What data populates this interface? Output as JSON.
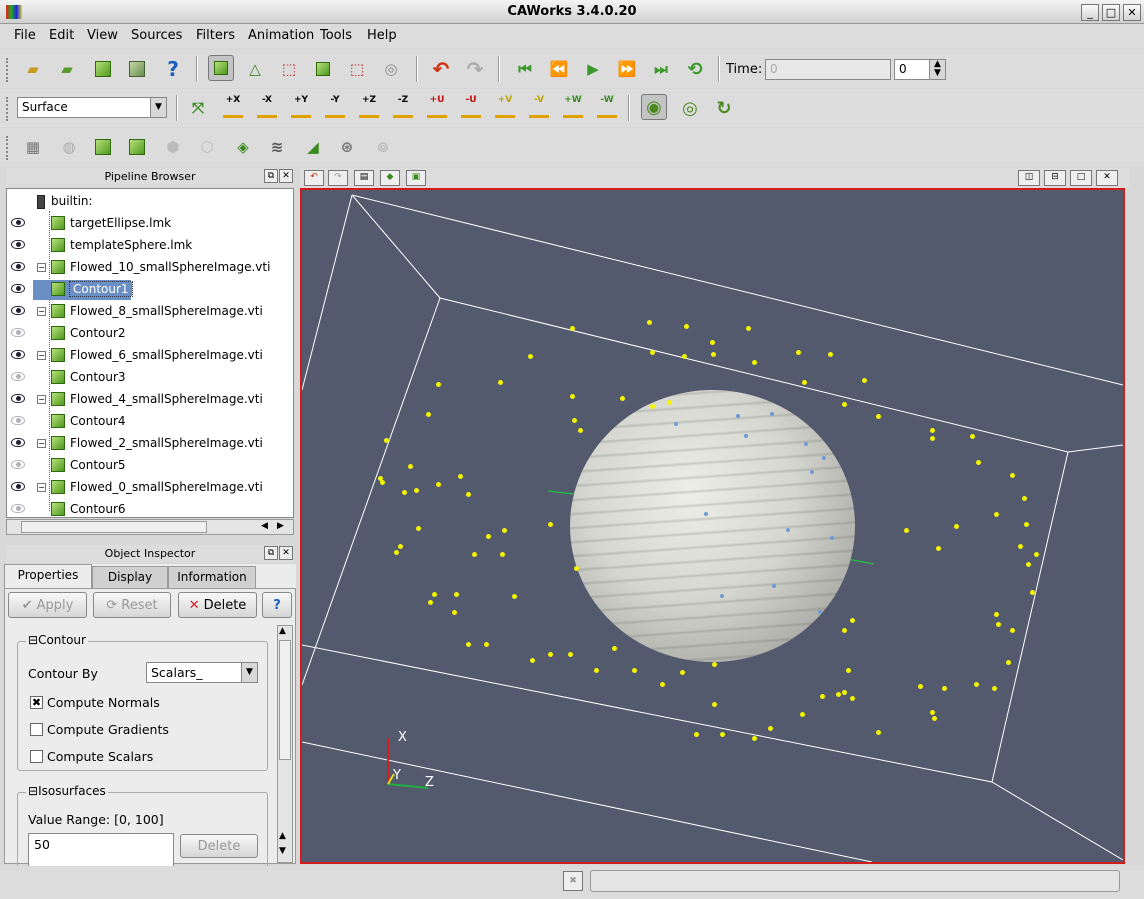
{
  "window": {
    "title": "CAWorks 3.4.0.20"
  },
  "menu": [
    "File",
    "Edit",
    "View",
    "Sources",
    "Filters",
    "Animation",
    "Tools",
    "Help"
  ],
  "time": {
    "label": "Time:",
    "value": "0",
    "index": "0"
  },
  "representation": "Surface",
  "axis_buttons": [
    "+X",
    "-X",
    "+Y",
    "-Y",
    "+Z",
    "-Z",
    "+U",
    "-U",
    "+V",
    "-V",
    "+W",
    "-W"
  ],
  "pipeline": {
    "title": "Pipeline Browser",
    "root": "builtin:",
    "items": [
      {
        "label": "targetEllipse.lmk",
        "visible": true,
        "level": 1
      },
      {
        "label": "templateSphere.lmk",
        "visible": true,
        "level": 1
      },
      {
        "label": "Flowed_10_smallSphereImage.vti",
        "visible": true,
        "level": 1,
        "expanded": true
      },
      {
        "label": "Contour1",
        "visible": true,
        "level": 2,
        "selected": true
      },
      {
        "label": "Flowed_8_smallSphereImage.vti",
        "visible": true,
        "level": 1,
        "expanded": true
      },
      {
        "label": "Contour2",
        "visible": false,
        "level": 2
      },
      {
        "label": "Flowed_6_smallSphereImage.vti",
        "visible": true,
        "level": 1,
        "expanded": true
      },
      {
        "label": "Contour3",
        "visible": false,
        "level": 2
      },
      {
        "label": "Flowed_4_smallSphereImage.vti",
        "visible": true,
        "level": 1,
        "expanded": true
      },
      {
        "label": "Contour4",
        "visible": false,
        "level": 2
      },
      {
        "label": "Flowed_2_smallSphereImage.vti",
        "visible": true,
        "level": 1,
        "expanded": true
      },
      {
        "label": "Contour5",
        "visible": false,
        "level": 2
      },
      {
        "label": "Flowed_0_smallSphereImage.vti",
        "visible": true,
        "level": 1,
        "expanded": true
      },
      {
        "label": "Contour6",
        "visible": false,
        "level": 2
      }
    ]
  },
  "inspector": {
    "title": "Object Inspector",
    "tabs": [
      "Properties",
      "Display",
      "Information"
    ],
    "apply": "Apply",
    "reset": "Reset",
    "delete": "Delete",
    "contour_group": "Contour",
    "contour_by_label": "Contour By",
    "contour_by_value": "Scalars_",
    "compute_normals": "Compute Normals",
    "compute_gradients": "Compute Gradients",
    "compute_scalars": "Compute Scalars",
    "iso_group": "Isosurfaces",
    "value_range": "Value Range: [0, 100]",
    "iso_value": "50",
    "iso_delete": "Delete"
  },
  "axes": {
    "x": "X",
    "y": "Y",
    "z": "Z"
  },
  "colors": {
    "viewport_bg": "#535a6e",
    "active_border": "#d21c1c",
    "landmark": "#f4f400"
  }
}
